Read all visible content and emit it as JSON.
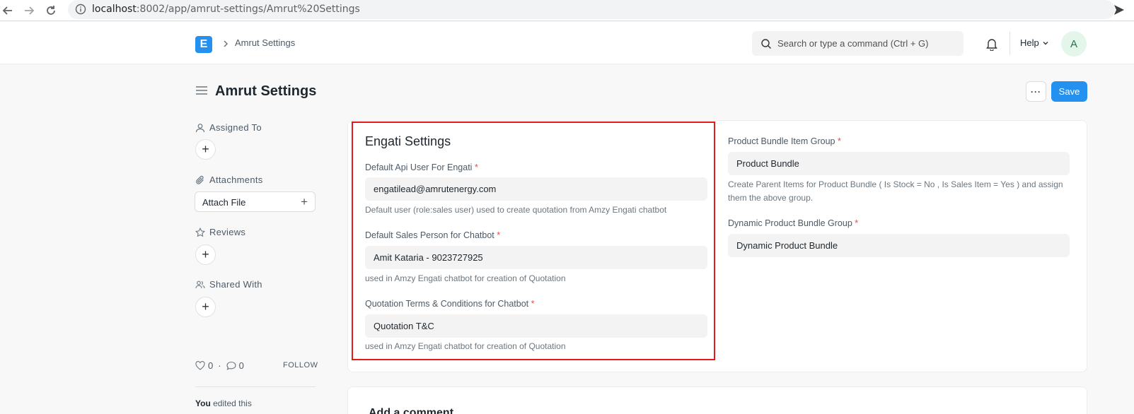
{
  "browser": {
    "url_host": "localhost",
    "url_rest": ":8002/app/amrut-settings/Amrut%20Settings"
  },
  "header": {
    "logo_letter": "E",
    "breadcrumb": "Amrut Settings",
    "search_placeholder": "Search or type a command (Ctrl + G)",
    "help_label": "Help",
    "avatar_letter": "A"
  },
  "page": {
    "title": "Amrut Settings",
    "more_label": "···",
    "save_label": "Save"
  },
  "sidebar": {
    "assigned_to": "Assigned To",
    "attachments": "Attachments",
    "attach_file": "Attach File",
    "reviews": "Reviews",
    "shared_with": "Shared With",
    "likes_count": "0",
    "comments_count": "0",
    "follow": "FOLLOW",
    "activity_user": "You",
    "activity_text": " edited this"
  },
  "form": {
    "section_title": "Engati Settings",
    "fields": [
      {
        "label": "Default Api User For Engati",
        "required": "*",
        "value": "engatilead@amrutenergy.com",
        "description": "Default user (role:sales user) used to create quotation from Amzy Engati chatbot"
      },
      {
        "label": "Default Sales Person for Chatbot",
        "required": "*",
        "value": "Amit Kataria - 9023727925",
        "description": "used in Amzy Engati chatbot for creation of Quotation"
      },
      {
        "label": "Quotation Terms & Conditions for Chatbot",
        "required": "*",
        "value": "Quotation T&C",
        "description": "used in Amzy Engati chatbot for creation of Quotation"
      },
      {
        "label": "Product Bundle Item Group",
        "required": "*",
        "value": "Product Bundle",
        "description": "Create Parent Items for Product Bundle ( Is Stock = No , Is Sales Item = Yes ) and assign them the above group."
      },
      {
        "label": "Dynamic Product Bundle Group",
        "required": "*",
        "value": "Dynamic Product Bundle",
        "description": ""
      }
    ]
  },
  "comments": {
    "title": "Add a comment"
  },
  "colors": {
    "primary": "#2490ef",
    "highlight_border": "#e01b1b",
    "required": "#e24c4c"
  }
}
